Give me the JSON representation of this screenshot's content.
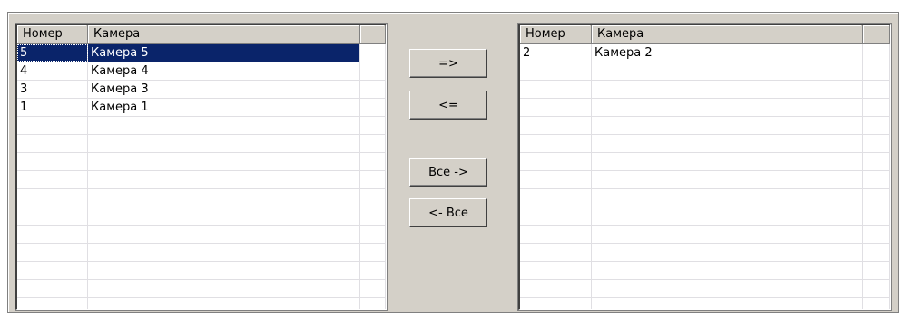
{
  "left_list": {
    "columns": [
      "Номер",
      "Камера",
      ""
    ],
    "rows": [
      {
        "num": "5",
        "name": "Камера 5",
        "selected": true
      },
      {
        "num": "4",
        "name": "Камера 4"
      },
      {
        "num": "3",
        "name": "Камера 3"
      },
      {
        "num": "1",
        "name": "Камера 1"
      }
    ]
  },
  "right_list": {
    "columns": [
      "Номер",
      "Камера",
      ""
    ],
    "rows": [
      {
        "num": "2",
        "name": "Камера 2"
      }
    ]
  },
  "buttons": {
    "move_right": "=>",
    "move_left": "<=",
    "move_all_right": "Все ->",
    "move_all_left": "<- Все"
  }
}
